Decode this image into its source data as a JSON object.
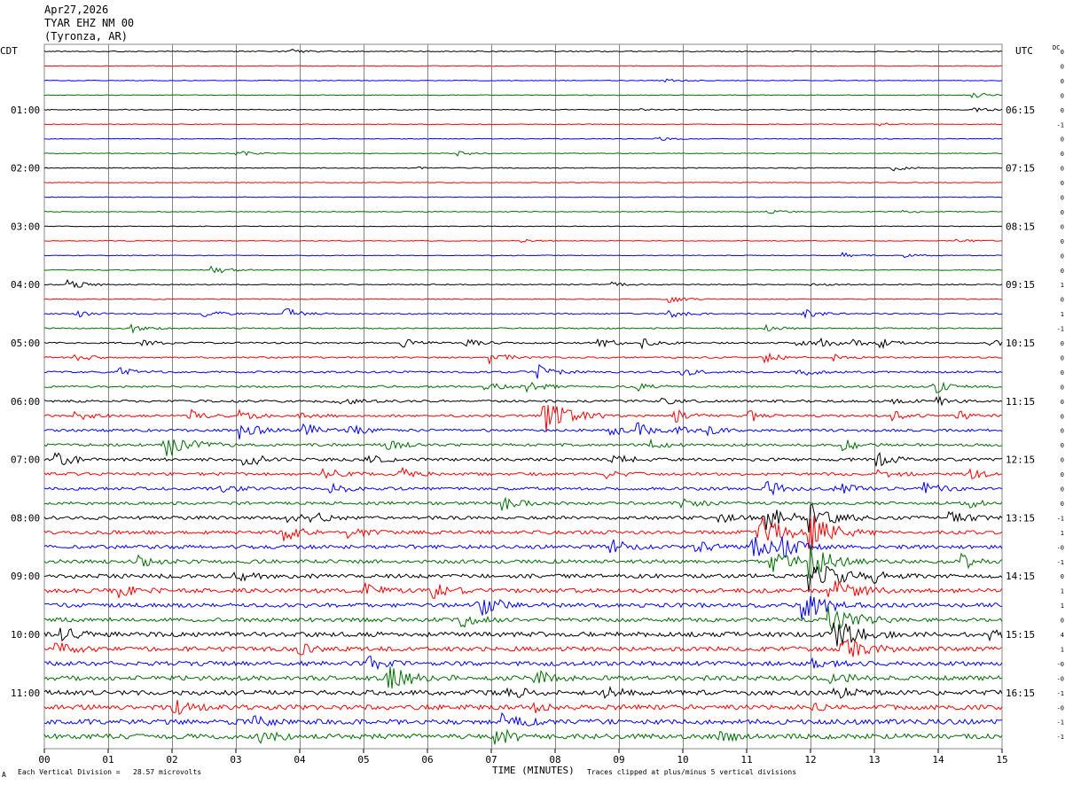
{
  "header": {
    "date": "Apr27,2026",
    "station": "TYAR EHZ NM 00",
    "location": "(Tyronza, AR)"
  },
  "left_zone_label": "CDT",
  "right_zone_label": "UTC",
  "dc_label": "DC",
  "footer": {
    "scale_note": "Each Vertical Division =   28.57 microvolts",
    "clip_note": "Traces clipped at plus/minus 5 vertical divisions",
    "corner_mark": "A"
  },
  "colors": {
    "trace_cycle": [
      "#000000",
      "#ff0000",
      "#0000ff",
      "#007000"
    ],
    "grid": "#888888"
  },
  "chart_data": {
    "type": "helicorder",
    "xlabel": "TIME (MINUTES)",
    "x_ticks": [
      "00",
      "01",
      "02",
      "03",
      "04",
      "05",
      "06",
      "07",
      "08",
      "09",
      "10",
      "11",
      "12",
      "13",
      "14",
      "15"
    ],
    "xlim": [
      0,
      15
    ],
    "minutes_per_line": 15,
    "line_count": 48,
    "left_hour_labels": [
      {
        "line": 4,
        "text": "01:00"
      },
      {
        "line": 8,
        "text": "02:00"
      },
      {
        "line": 12,
        "text": "03:00"
      },
      {
        "line": 16,
        "text": "04:00"
      },
      {
        "line": 20,
        "text": "05:00"
      },
      {
        "line": 24,
        "text": "06:00"
      },
      {
        "line": 28,
        "text": "07:00"
      },
      {
        "line": 32,
        "text": "08:00"
      },
      {
        "line": 36,
        "text": "09:00"
      },
      {
        "line": 40,
        "text": "10:00"
      },
      {
        "line": 44,
        "text": "11:00"
      }
    ],
    "right_hour_labels": [
      {
        "line": 4,
        "text": "06:15"
      },
      {
        "line": 8,
        "text": "07:15"
      },
      {
        "line": 12,
        "text": "08:15"
      },
      {
        "line": 16,
        "text": "09:15"
      },
      {
        "line": 20,
        "text": "10:15"
      },
      {
        "line": 24,
        "text": "11:15"
      },
      {
        "line": 28,
        "text": "12:15"
      },
      {
        "line": 32,
        "text": "13:15"
      },
      {
        "line": 36,
        "text": "14:15"
      },
      {
        "line": 40,
        "text": "15:15"
      },
      {
        "line": 44,
        "text": "16:15"
      }
    ],
    "dc_offsets": [
      "0",
      "0",
      "0",
      "0",
      "0",
      "-1",
      "0",
      "0",
      "0",
      "0",
      "0",
      "0",
      "0",
      "0",
      "0",
      "0",
      "1",
      "0",
      "1",
      "-1",
      "0",
      "0",
      "0",
      "0",
      "0",
      "0",
      "0",
      "0",
      "0",
      "0",
      "0",
      "0",
      "-1",
      "1",
      "-0",
      "-1",
      "0",
      "1",
      "1",
      "0",
      "4",
      "1",
      "-0",
      "-0",
      "-1",
      "-0",
      "-1",
      "-1"
    ],
    "noise": [
      0.6,
      0.4,
      0.4,
      0.4,
      0.5,
      0.4,
      0.4,
      0.4,
      0.5,
      0.4,
      0.4,
      0.5,
      0.4,
      0.4,
      0.4,
      0.4,
      0.6,
      0.5,
      0.7,
      0.7,
      0.9,
      0.9,
      1.1,
      1.1,
      1.3,
      1.3,
      1.5,
      1.5,
      1.7,
      1.6,
      1.7,
      1.7,
      1.9,
      2.0,
      2.1,
      2.1,
      2.3,
      2.4,
      2.3,
      2.3,
      2.6,
      2.5,
      2.5,
      2.6,
      2.7,
      2.7,
      2.8,
      2.8
    ],
    "events": [
      [
        [
          3.9,
          2
        ]
      ],
      [],
      [
        [
          9.75,
          1.5
        ]
      ],
      [
        [
          14.55,
          4
        ]
      ],
      [
        [
          9.3,
          1.5
        ],
        [
          14.6,
          2
        ]
      ],
      [
        [
          13.1,
          1.5
        ]
      ],
      [
        [
          9.6,
          2
        ]
      ],
      [
        [
          3.05,
          3
        ],
        [
          6.5,
          2.5
        ]
      ],
      [
        [
          5.9,
          1
        ],
        [
          13.3,
          3
        ]
      ],
      [],
      [],
      [
        [
          11.3,
          3
        ],
        [
          13.4,
          2
        ]
      ],
      [],
      [
        [
          7.5,
          1.5
        ],
        [
          14.3,
          2
        ]
      ],
      [
        [
          12.5,
          3
        ],
        [
          13.5,
          2
        ]
      ],
      [
        [
          2.65,
          5
        ]
      ],
      [
        [
          0.4,
          5
        ],
        [
          8.9,
          2.5
        ],
        [
          12.0,
          1.5
        ]
      ],
      [
        [
          9.8,
          4
        ]
      ],
      [
        [
          0.5,
          4
        ],
        [
          2.5,
          5
        ],
        [
          3.8,
          6
        ],
        [
          9.8,
          5
        ],
        [
          11.9,
          5
        ]
      ],
      [
        [
          1.4,
          4
        ],
        [
          11.3,
          3
        ]
      ],
      [
        [
          1.55,
          3
        ],
        [
          5.6,
          5
        ],
        [
          6.6,
          6
        ],
        [
          8.7,
          5
        ],
        [
          9.4,
          5
        ],
        [
          11.8,
          5
        ],
        [
          12.2,
          4
        ],
        [
          12.7,
          4
        ],
        [
          13.1,
          5
        ],
        [
          14.8,
          5
        ]
      ],
      [
        [
          0.5,
          4
        ],
        [
          7.0,
          7
        ],
        [
          11.3,
          5
        ],
        [
          12.4,
          3
        ]
      ],
      [
        [
          1.2,
          4
        ],
        [
          7.75,
          8
        ],
        [
          10.0,
          4
        ],
        [
          11.8,
          5
        ]
      ],
      [
        [
          6.9,
          6
        ],
        [
          7.6,
          6
        ],
        [
          9.3,
          5
        ],
        [
          13.95,
          7
        ]
      ],
      [
        [
          4.6,
          5
        ],
        [
          9.7,
          3
        ],
        [
          13.3,
          3
        ],
        [
          14.0,
          4
        ]
      ],
      [
        [
          0.5,
          5
        ],
        [
          2.3,
          6
        ],
        [
          3.1,
          5
        ],
        [
          4.0,
          5
        ],
        [
          7.85,
          20
        ],
        [
          9.9,
          6
        ],
        [
          11.0,
          8
        ],
        [
          13.3,
          5
        ],
        [
          14.3,
          7
        ]
      ],
      [
        [
          3.1,
          9
        ],
        [
          4.1,
          7
        ],
        [
          4.8,
          6
        ],
        [
          8.9,
          6
        ],
        [
          9.3,
          7
        ],
        [
          9.9,
          5
        ],
        [
          10.4,
          5
        ]
      ],
      [
        [
          1.9,
          14
        ],
        [
          5.4,
          5
        ],
        [
          9.5,
          5
        ],
        [
          12.5,
          6
        ]
      ],
      [
        [
          0.2,
          9
        ],
        [
          3.15,
          9
        ],
        [
          5.0,
          6
        ],
        [
          8.9,
          6
        ],
        [
          13.05,
          7
        ]
      ],
      [
        [
          4.4,
          6
        ],
        [
          5.6,
          6
        ],
        [
          8.8,
          4
        ],
        [
          13.1,
          5
        ],
        [
          14.5,
          5
        ]
      ],
      [
        [
          2.8,
          4
        ],
        [
          4.5,
          6
        ],
        [
          11.35,
          8
        ],
        [
          12.4,
          7
        ],
        [
          13.8,
          6
        ]
      ],
      [
        [
          7.2,
          8
        ],
        [
          10.0,
          5
        ],
        [
          14.5,
          4
        ]
      ],
      [
        [
          3.8,
          5
        ],
        [
          4.2,
          5
        ],
        [
          10.6,
          5
        ],
        [
          11.3,
          12
        ],
        [
          12.0,
          15
        ],
        [
          14.2,
          7
        ]
      ],
      [
        [
          3.8,
          9
        ],
        [
          4.8,
          6
        ],
        [
          11.2,
          18
        ],
        [
          12.0,
          20
        ]
      ],
      [
        [
          8.9,
          8
        ],
        [
          10.2,
          7
        ],
        [
          11.1,
          12
        ],
        [
          11.6,
          10
        ]
      ],
      [
        [
          1.5,
          5
        ],
        [
          11.4,
          12
        ],
        [
          12.0,
          16
        ],
        [
          14.4,
          7
        ]
      ],
      [
        [
          3.0,
          5
        ],
        [
          12.0,
          20
        ],
        [
          13.0,
          7
        ]
      ],
      [
        [
          1.2,
          6
        ],
        [
          5.0,
          7
        ],
        [
          6.1,
          8
        ],
        [
          12.3,
          12
        ]
      ],
      [
        [
          6.8,
          12
        ],
        [
          11.9,
          15
        ]
      ],
      [
        [
          6.5,
          9
        ],
        [
          12.3,
          15
        ]
      ],
      [
        [
          0.2,
          10
        ],
        [
          12.4,
          15
        ],
        [
          14.8,
          5
        ]
      ],
      [
        [
          0.2,
          8
        ],
        [
          4.0,
          5
        ],
        [
          12.5,
          12
        ]
      ],
      [
        [
          5.1,
          7
        ],
        [
          12.0,
          6
        ]
      ],
      [
        [
          5.4,
          12
        ],
        [
          7.7,
          8
        ],
        [
          12.3,
          7
        ]
      ],
      [
        [
          7.3,
          6
        ],
        [
          8.8,
          7
        ],
        [
          12.4,
          6
        ]
      ],
      [
        [
          2.05,
          8
        ],
        [
          7.7,
          5
        ],
        [
          12.0,
          5
        ]
      ],
      [
        [
          7.2,
          10
        ],
        [
          3.3,
          5
        ]
      ],
      [
        [
          3.4,
          7
        ],
        [
          7.1,
          9
        ],
        [
          10.6,
          5
        ]
      ]
    ]
  }
}
